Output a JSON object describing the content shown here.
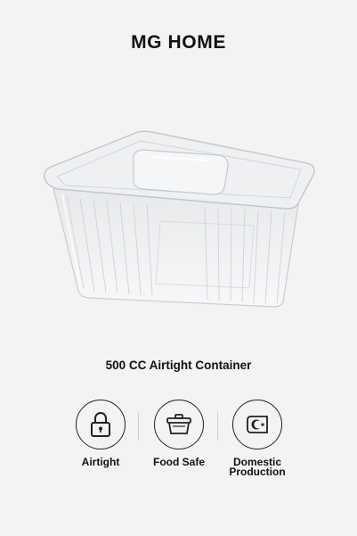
{
  "brand": "MG HOME",
  "product": {
    "image_alt": "clear plastic airtight container",
    "caption": "500 CC Airtight Container"
  },
  "features": [
    {
      "label": "Airtight",
      "icon": "lock-icon"
    },
    {
      "label": "Food Safe",
      "icon": "food-container-icon"
    },
    {
      "label": "Domestic\nProduction",
      "icon": "turkey-flag-icon"
    }
  ],
  "colors": {
    "background": "#f3f3f3",
    "text": "#111111"
  }
}
